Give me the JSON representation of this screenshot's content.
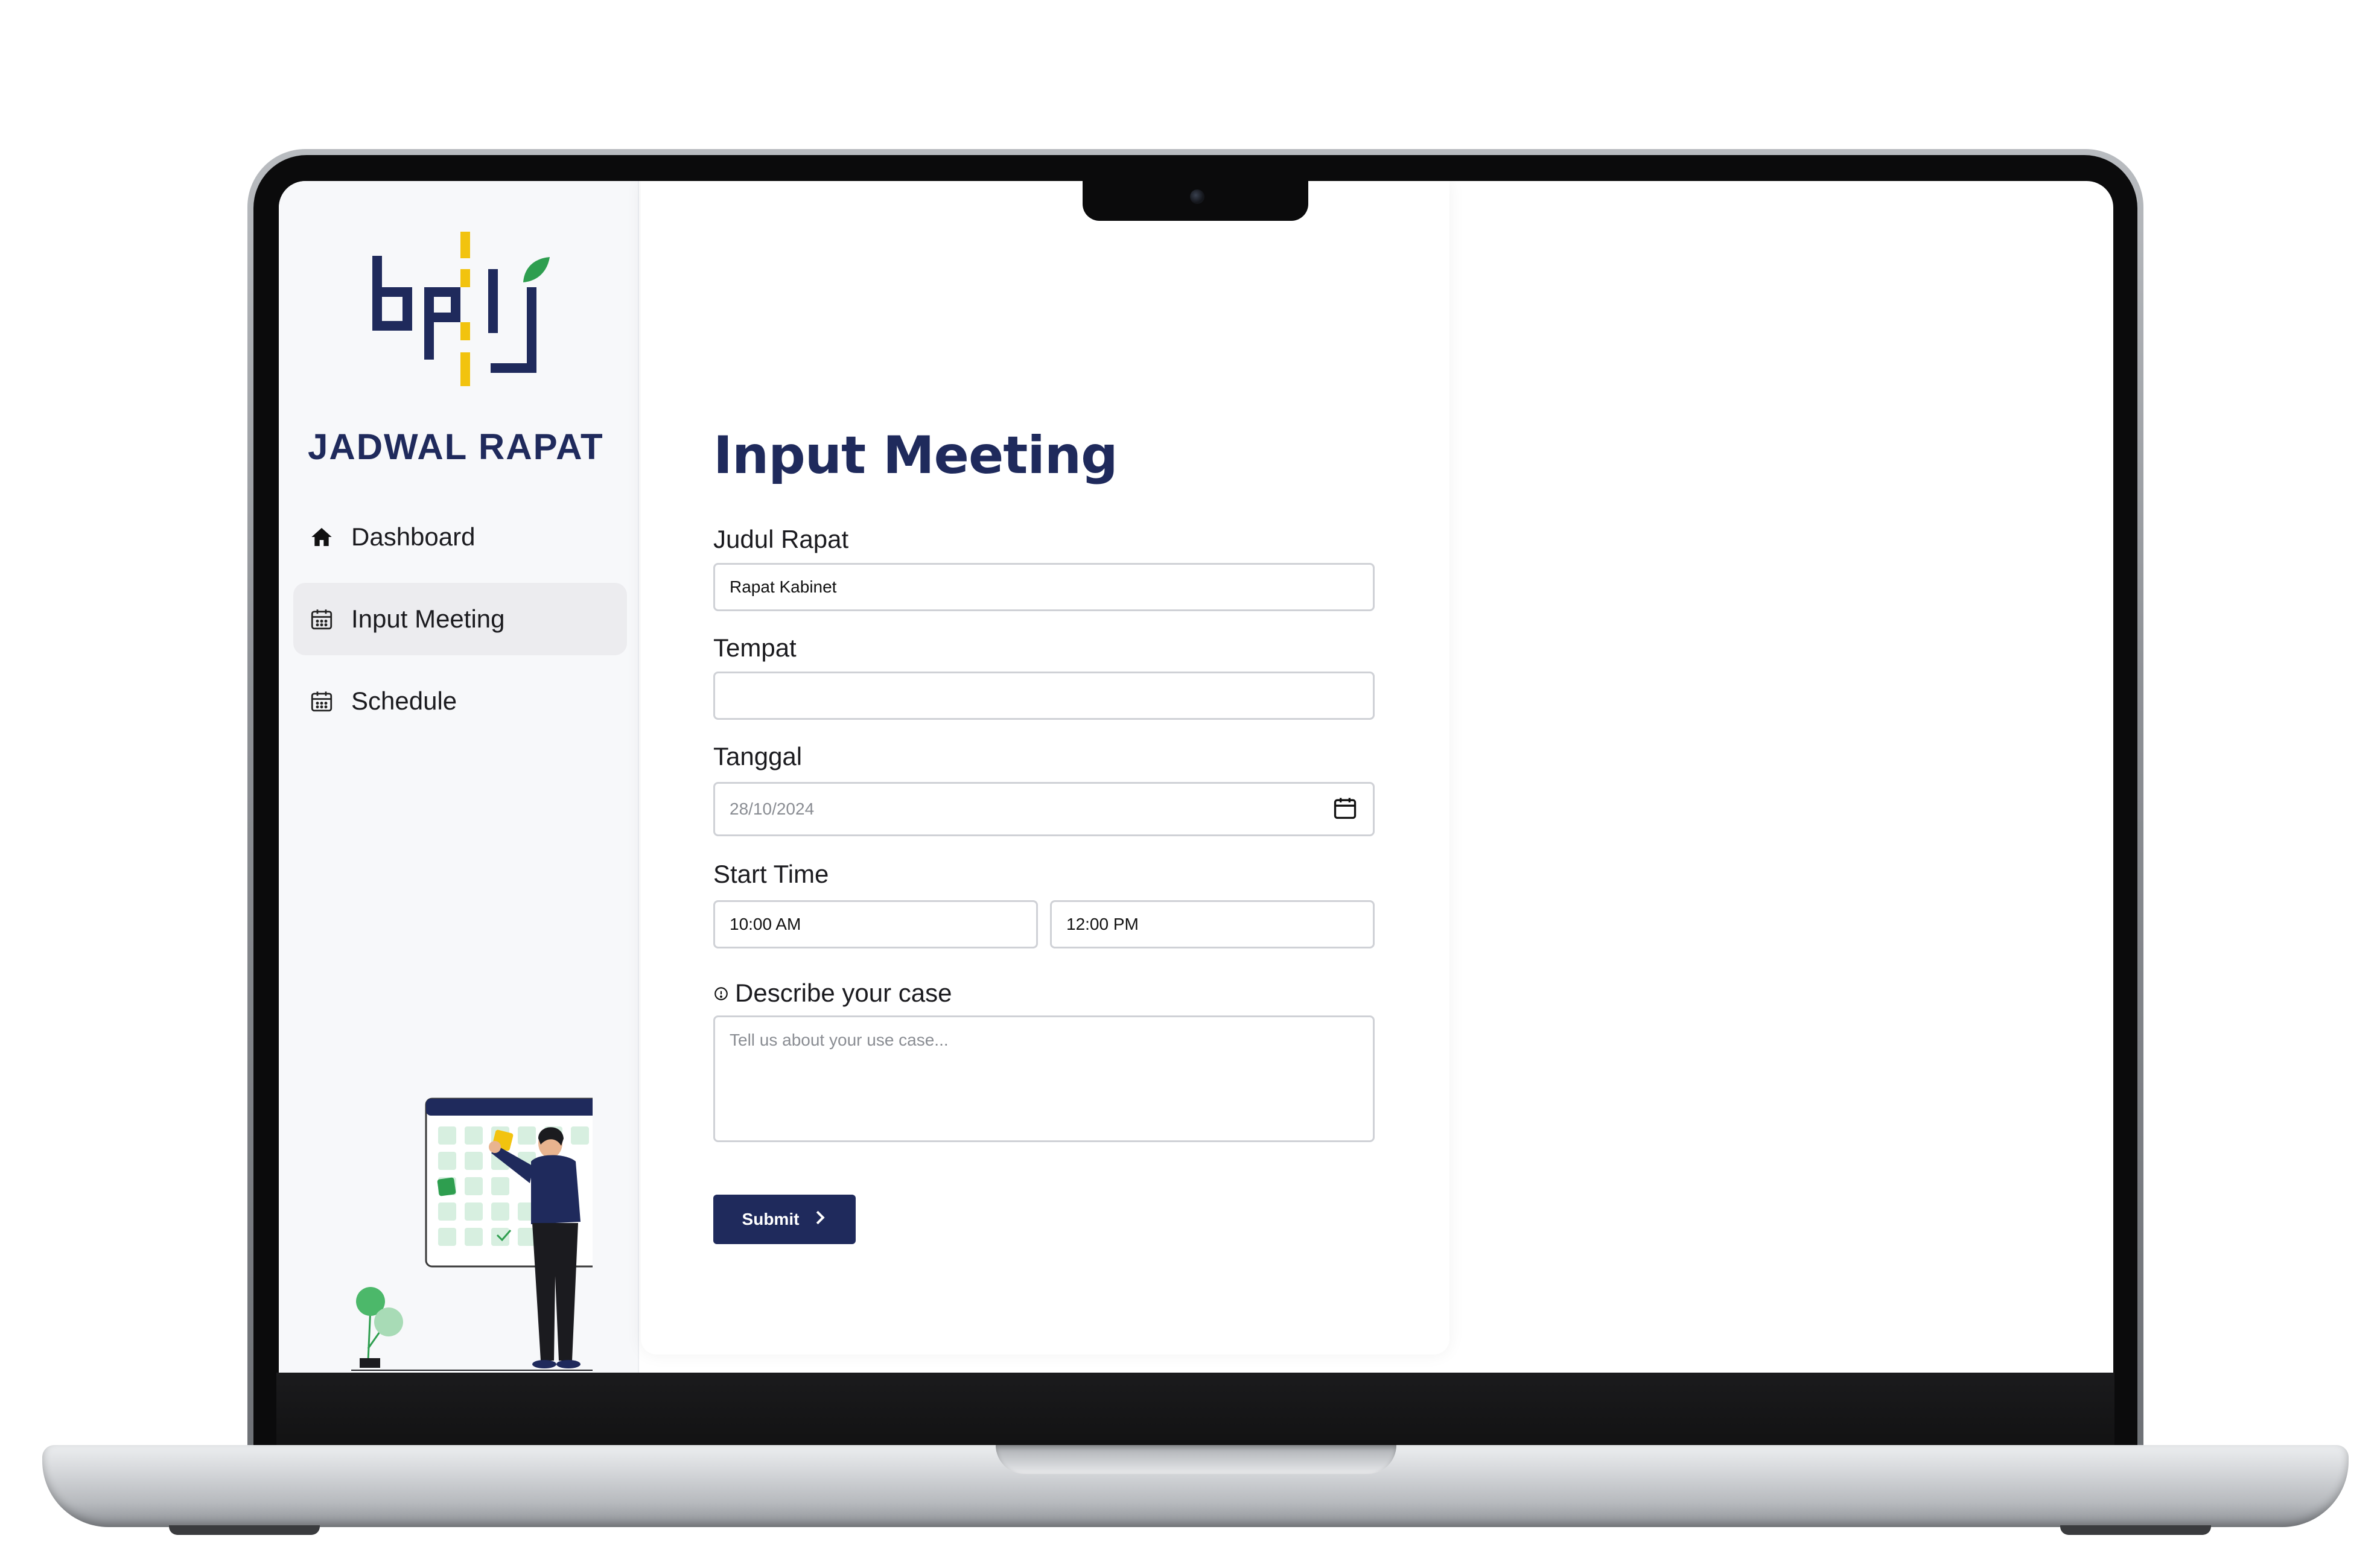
{
  "sidebar": {
    "app_title": "JADWAL RAPAT",
    "items": [
      {
        "label": "Dashboard",
        "icon": "home-icon",
        "active": false
      },
      {
        "label": "Input Meeting",
        "icon": "calendar-icon",
        "active": true
      },
      {
        "label": "Schedule",
        "icon": "calendar-icon",
        "active": false
      }
    ]
  },
  "form": {
    "title": "Input Meeting",
    "judul_label": "Judul Rapat",
    "judul_value": "Rapat Kabinet",
    "tempat_label": "Tempat",
    "tempat_value": "",
    "tanggal_label": "Tanggal",
    "tanggal_value": "28/10/2024",
    "start_time_label": "Start Time",
    "start_time_value": "10:00 AM",
    "end_time_value": "12:00 PM",
    "describe_label": "Describe your case",
    "describe_placeholder": "Tell us about your use case...",
    "submit_label": "Submit"
  },
  "colors": {
    "brand_navy": "#1f2a5c",
    "logo_yellow": "#f2c30f",
    "logo_green": "#2e9e4f",
    "sidebar_bg": "#f7f8fa"
  }
}
